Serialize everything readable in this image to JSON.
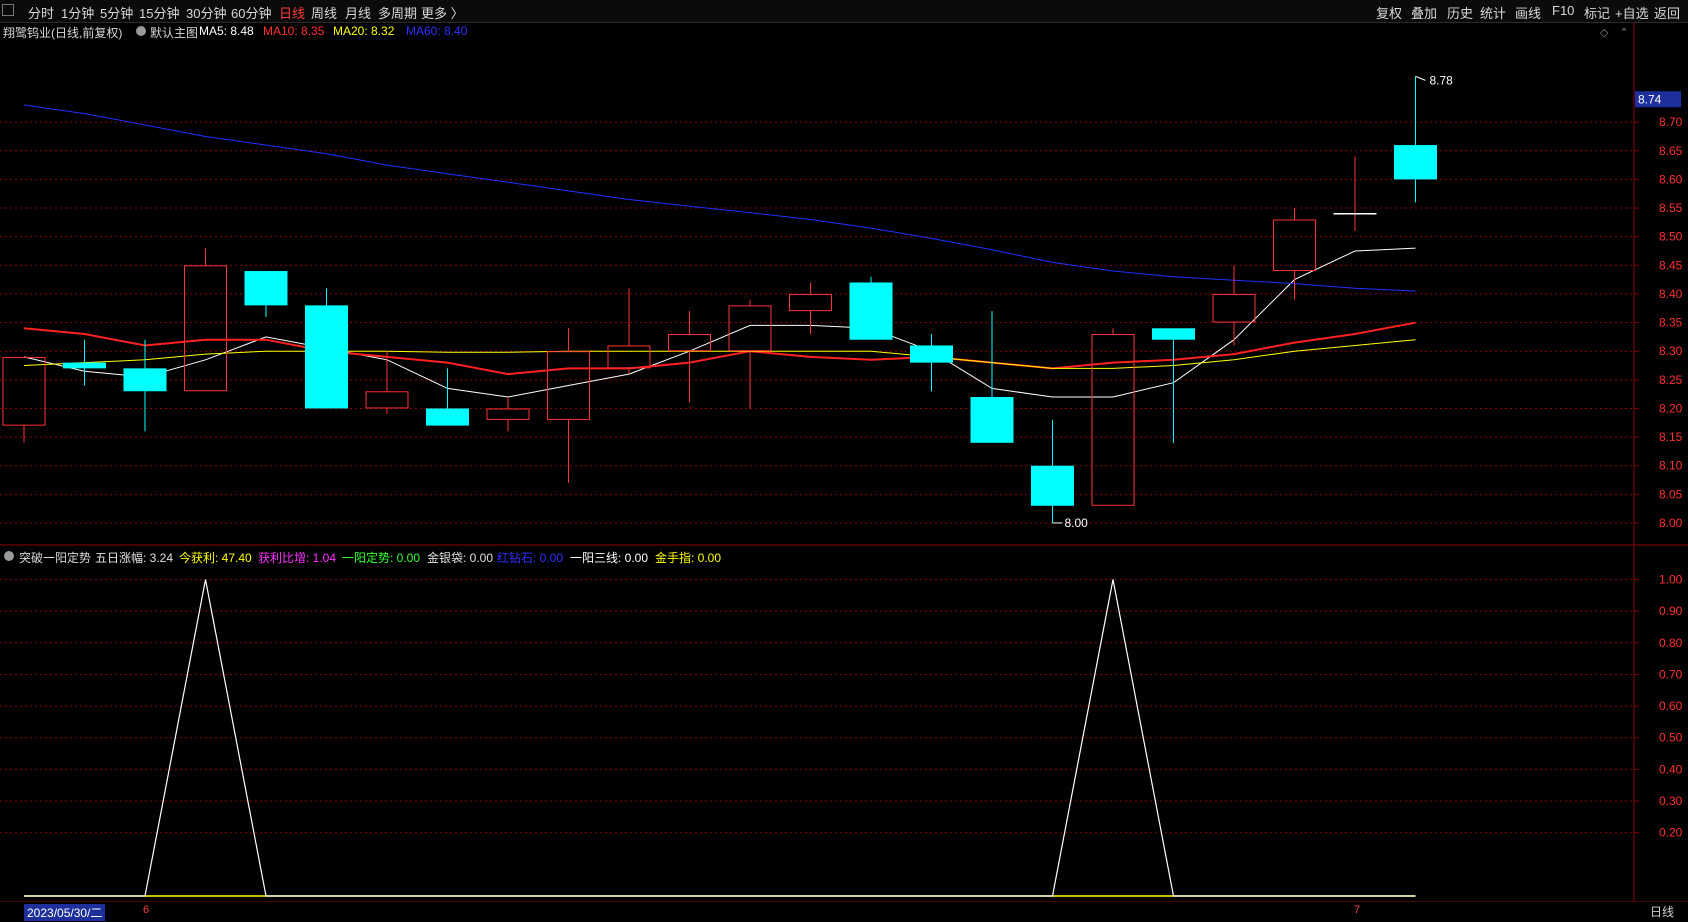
{
  "toolbar": {
    "left_items": [
      "分时",
      "1分钟",
      "5分钟",
      "15分钟",
      "30分钟",
      "60分钟",
      "日线",
      "周线",
      "月线",
      "多周期",
      "更多 〉"
    ],
    "active": "日线",
    "right_items": [
      "复权",
      "叠加",
      "历史",
      "统计",
      "画线",
      "F10",
      "标记",
      "+自选",
      "返回"
    ]
  },
  "main_panel": {
    "stock": "翔鹭钨业(日线,前复权)",
    "template": "默认主图",
    "ma_labels": [
      {
        "text": "MA5: 8.48",
        "color": "#ffffff"
      },
      {
        "text": "MA10: 8.35",
        "color": "#ff3030"
      },
      {
        "text": "MA20: 8.32",
        "color": "#ffff00"
      },
      {
        "text": "MA60: 8.40",
        "color": "#3030ff"
      }
    ]
  },
  "indicator_panel": {
    "name": "突破一阳定势",
    "values": [
      {
        "text": "五日涨幅: 3.24",
        "color": "#e0e0e0"
      },
      {
        "text": "今获利: 47.40",
        "color": "#ffff00"
      },
      {
        "text": "获利比增: 1.04",
        "color": "#ff30ff"
      },
      {
        "text": "一阳定势: 0.00",
        "color": "#30ff30"
      },
      {
        "text": "金银袋: 0.00",
        "color": "#e0e0e0"
      },
      {
        "text": "红钻石: 0.00",
        "color": "#3030ff"
      },
      {
        "text": "一阳三线: 0.00",
        "color": "#ffffff"
      },
      {
        "text": "金手指: 0.00",
        "color": "#ffff00"
      }
    ]
  },
  "bottom": {
    "date": "2023/05/30/二",
    "marks": [
      "6",
      "7"
    ],
    "period": "日线"
  },
  "colors": {
    "up": "#ff3232",
    "down": "#00ffff",
    "grid": "#8b0000",
    "axis_text": "#ff3030",
    "ma5": "#ffffff",
    "ma10": "#ff2020",
    "ma20": "#ffff00",
    "ma60": "#2030ff"
  },
  "chart_data": {
    "type": "candlestick",
    "price_axis": {
      "ticks": [
        "8.70",
        "8.65",
        "8.60",
        "8.55",
        "8.50",
        "8.45",
        "8.40",
        "8.35",
        "8.30",
        "8.25",
        "8.20",
        "8.15",
        "8.10",
        "8.05",
        "8.00"
      ],
      "current_price": "8.74",
      "ylim": [
        7.965,
        8.84
      ]
    },
    "high_label": "8.78",
    "low_label": "8.00",
    "candles": [
      {
        "open": 8.17,
        "close": 8.29,
        "high": 8.29,
        "low": 8.14
      },
      {
        "open": 8.28,
        "close": 8.27,
        "high": 8.32,
        "low": 8.24
      },
      {
        "open": 8.27,
        "close": 8.23,
        "high": 8.32,
        "low": 8.16
      },
      {
        "open": 8.23,
        "close": 8.45,
        "high": 8.48,
        "low": 8.23
      },
      {
        "open": 8.44,
        "close": 8.38,
        "high": 8.44,
        "low": 8.36
      },
      {
        "open": 8.38,
        "close": 8.2,
        "high": 8.41,
        "low": 8.2
      },
      {
        "open": 8.2,
        "close": 8.23,
        "high": 8.3,
        "low": 8.19
      },
      {
        "open": 8.2,
        "close": 8.17,
        "high": 8.27,
        "low": 8.17
      },
      {
        "open": 8.18,
        "close": 8.2,
        "high": 8.22,
        "low": 8.16
      },
      {
        "open": 8.18,
        "close": 8.3,
        "high": 8.34,
        "low": 8.07
      },
      {
        "open": 8.27,
        "close": 8.31,
        "high": 8.41,
        "low": 8.26
      },
      {
        "open": 8.3,
        "close": 8.33,
        "high": 8.37,
        "low": 8.21
      },
      {
        "open": 8.3,
        "close": 8.38,
        "high": 8.39,
        "low": 8.2
      },
      {
        "open": 8.37,
        "close": 8.4,
        "high": 8.42,
        "low": 8.33
      },
      {
        "open": 8.42,
        "close": 8.32,
        "high": 8.43,
        "low": 8.32
      },
      {
        "open": 8.31,
        "close": 8.28,
        "high": 8.33,
        "low": 8.23
      },
      {
        "open": 8.22,
        "close": 8.14,
        "high": 8.37,
        "low": 8.14
      },
      {
        "open": 8.1,
        "close": 8.03,
        "high": 8.18,
        "low": 8.0
      },
      {
        "open": 8.03,
        "close": 8.33,
        "high": 8.34,
        "low": 8.03
      },
      {
        "open": 8.34,
        "close": 8.32,
        "high": 8.34,
        "low": 8.14
      },
      {
        "open": 8.35,
        "close": 8.4,
        "high": 8.45,
        "low": 8.31
      },
      {
        "open": 8.44,
        "close": 8.53,
        "high": 8.55,
        "low": 8.39
      },
      {
        "open": 8.54,
        "close": 8.54,
        "high": 8.64,
        "low": 8.51
      },
      {
        "open": 8.66,
        "close": 8.6,
        "high": 8.78,
        "low": 8.56
      }
    ],
    "series": [
      {
        "name": "MA5",
        "values": [
          8.29,
          8.265,
          8.255,
          8.285,
          8.325,
          8.305,
          8.285,
          8.235,
          8.22,
          8.24,
          8.26,
          8.3,
          8.345,
          8.345,
          8.34,
          8.3,
          8.235,
          8.22,
          8.22,
          8.245,
          8.32,
          8.425,
          8.475,
          8.48
        ]
      },
      {
        "name": "MA10",
        "values": [
          8.34,
          8.33,
          8.31,
          8.32,
          8.32,
          8.3,
          8.29,
          8.28,
          8.26,
          8.27,
          8.27,
          8.28,
          8.3,
          8.29,
          8.285,
          8.29,
          8.28,
          8.27,
          8.28,
          8.285,
          8.295,
          8.315,
          8.33,
          8.35
        ]
      },
      {
        "name": "MA20",
        "values": [
          8.275,
          8.28,
          8.285,
          8.295,
          8.3,
          8.3,
          8.3,
          8.298,
          8.298,
          8.3,
          8.3,
          8.3,
          8.3,
          8.3,
          8.3,
          8.29,
          8.28,
          8.27,
          8.27,
          8.275,
          8.285,
          8.3,
          8.31,
          8.32
        ]
      },
      {
        "name": "MA60",
        "values": [
          8.73,
          8.715,
          8.695,
          8.675,
          8.66,
          8.645,
          8.625,
          8.61,
          8.595,
          8.58,
          8.565,
          8.553,
          8.542,
          8.53,
          8.515,
          8.497,
          8.477,
          8.455,
          8.44,
          8.43,
          8.424,
          8.418,
          8.41,
          8.405
        ]
      }
    ],
    "indicator": {
      "ticks": [
        "1.00",
        "0.90",
        "0.80",
        "0.70",
        "0.60",
        "0.50",
        "0.40",
        "0.30",
        "0.20"
      ],
      "ylim": [
        0,
        1.03
      ],
      "signal": [
        0,
        0,
        0,
        1,
        0,
        0,
        0,
        0,
        0,
        0,
        0,
        0,
        0,
        0,
        0,
        0,
        0,
        0,
        1,
        0,
        0,
        0,
        0,
        0
      ]
    }
  }
}
